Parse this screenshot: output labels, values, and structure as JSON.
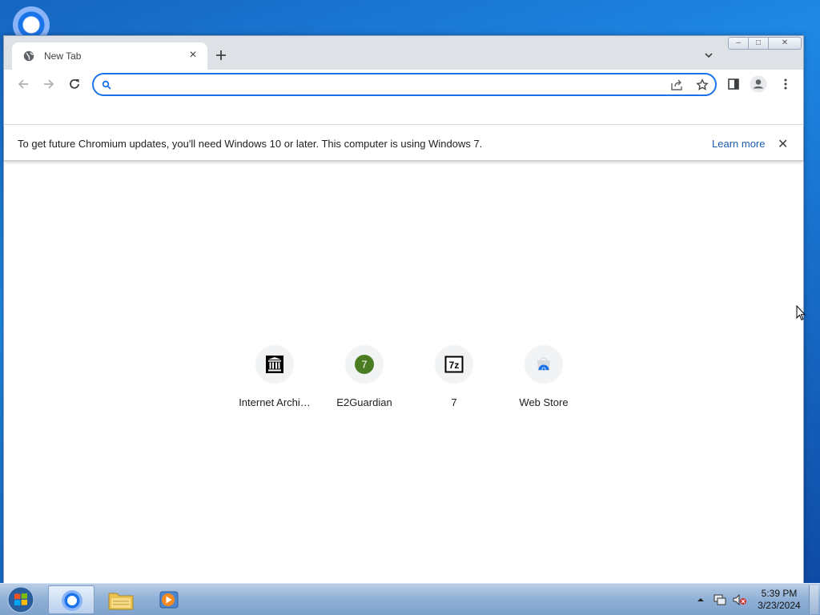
{
  "tab": {
    "title": "New Tab",
    "close_symbol": "×",
    "favicon": "globe-icon"
  },
  "window_controls": {
    "minimize": "–",
    "maximize": "□",
    "close": "✕"
  },
  "toolbar": {
    "back": "back-arrow-icon",
    "forward": "forward-arrow-icon",
    "reload": "reload-icon",
    "omnibox_value": "",
    "omnibox_placeholder": ""
  },
  "infobar": {
    "message": "To get future Chromium updates, you'll need Windows 10 or later. This computer is using Windows 7.",
    "link": "Learn more",
    "close_symbol": "✕"
  },
  "shortcuts": [
    {
      "label": "Internet Archi…",
      "icon": "internet-archive-icon"
    },
    {
      "label": "E2Guardian",
      "icon": "e2guardian-icon",
      "badge": "7"
    },
    {
      "label": "7",
      "icon": "7zip-icon",
      "badge": "7z"
    },
    {
      "label": "Web Store",
      "icon": "web-store-icon"
    }
  ],
  "taskbar": {
    "time": "5:39 PM",
    "date": "3/23/2024"
  },
  "colors": {
    "accent": "#1a73e8",
    "link": "#1a5cad",
    "e2guardian_green": "#4a7d22"
  }
}
